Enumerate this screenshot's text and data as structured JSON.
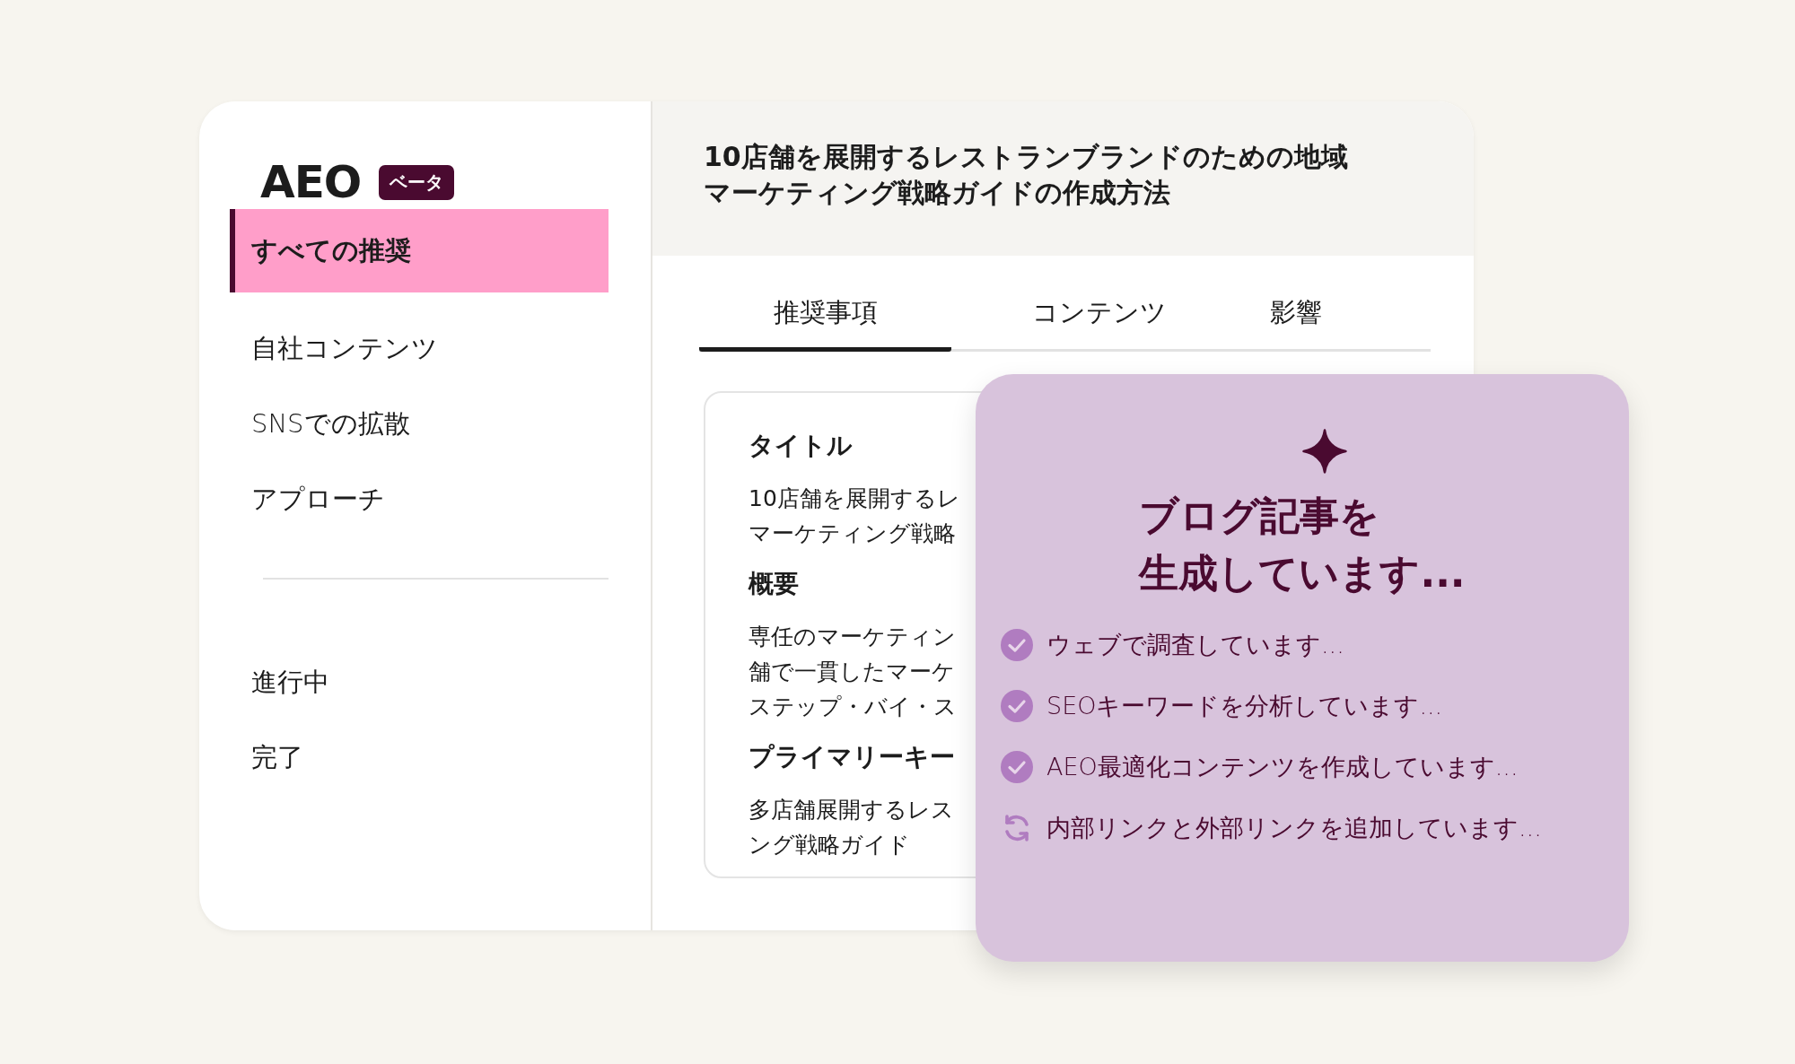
{
  "sidebar": {
    "logo": "AEO",
    "badge": "ベータ",
    "items": [
      {
        "label": "すべての推奨",
        "selected": true
      },
      {
        "label": "自社コンテンツ",
        "selected": false
      },
      {
        "label": "SNSでの拡散",
        "selected": false
      },
      {
        "label": "アプローチ",
        "selected": false
      }
    ],
    "status_items": [
      {
        "label": "進行中",
        "selected": false
      },
      {
        "label": "完了",
        "selected": false
      }
    ]
  },
  "header": {
    "title_lines": [
      "10店舗を展開するレストランブランドのための地域",
      "マーケティング戦略ガイドの作成方法"
    ]
  },
  "tabs": [
    {
      "label": "推奨事項",
      "selected": true
    },
    {
      "label": "コンテンツ",
      "selected": false
    },
    {
      "label": "影響",
      "selected": false
    }
  ],
  "content_card": {
    "sections": [
      {
        "heading": "タイトル",
        "lines": [
          "10店舗を展開するレ",
          "マーケティング戦略"
        ]
      },
      {
        "heading": "概要",
        "lines": [
          "専任のマーケティン",
          "舗で一貫したマーケ",
          "ステップ・バイ・ス"
        ]
      },
      {
        "heading": "プライマリーキー",
        "lines": [
          "多店舗展開するレス",
          "ング戦略ガイド"
        ]
      }
    ]
  },
  "progress_panel": {
    "title_lines": [
      "ブログ記事を",
      "生成しています..."
    ],
    "steps": [
      {
        "kind": "done",
        "label": "ウェブで調査しています..."
      },
      {
        "kind": "done",
        "label": "SEOキーワードを分析しています..."
      },
      {
        "kind": "done",
        "label": "AEO最適化コンテンツを作成しています..."
      },
      {
        "kind": "running",
        "label": "内部リンクと外部リンクを追加しています..."
      }
    ]
  }
}
